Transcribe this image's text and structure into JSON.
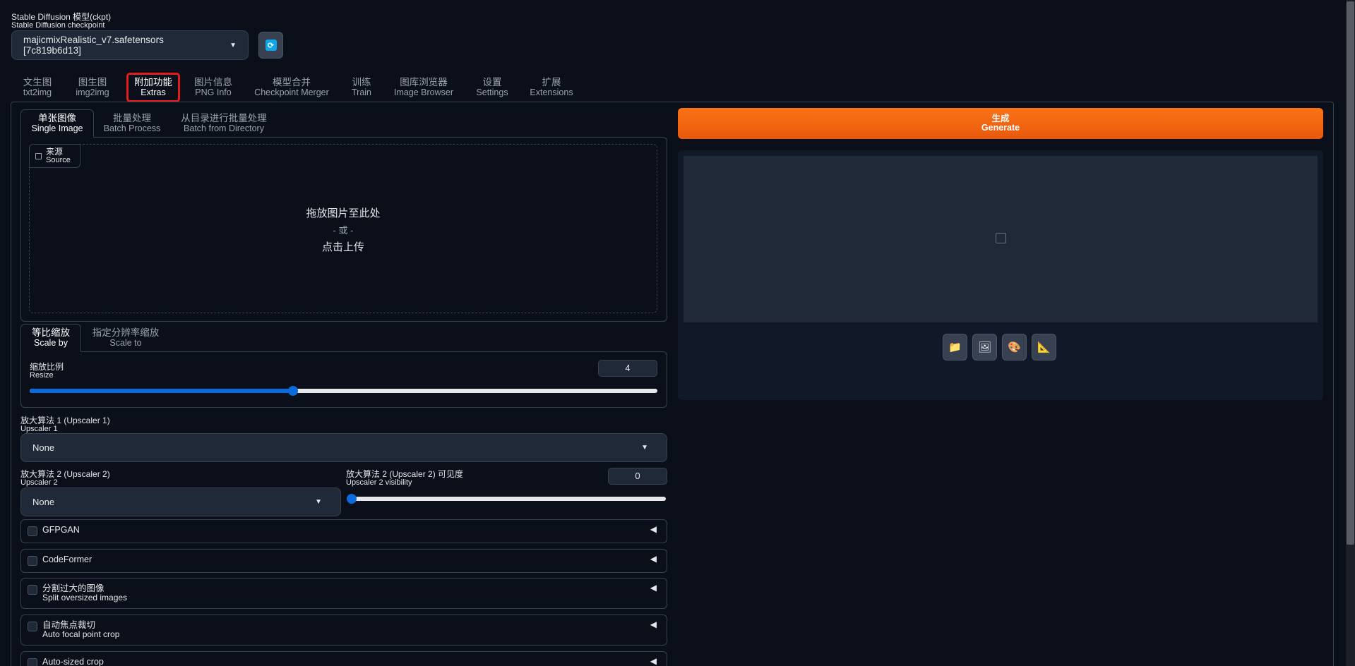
{
  "checkpoint": {
    "label_cn": "Stable Diffusion 模型(ckpt)",
    "label_en": "Stable Diffusion checkpoint",
    "value": "majicmixRealistic_v7.safetensors [7c819b6d13]",
    "refresh_icon": "refresh-icon"
  },
  "main_tabs": [
    {
      "cn": "文生图",
      "en": "txt2img"
    },
    {
      "cn": "图生图",
      "en": "img2img"
    },
    {
      "cn": "附加功能",
      "en": "Extras"
    },
    {
      "cn": "图片信息",
      "en": "PNG Info"
    },
    {
      "cn": "模型合并",
      "en": "Checkpoint Merger"
    },
    {
      "cn": "训练",
      "en": "Train"
    },
    {
      "cn": "图库浏览器",
      "en": "Image Browser"
    },
    {
      "cn": "设置",
      "en": "Settings"
    },
    {
      "cn": "扩展",
      "en": "Extensions"
    }
  ],
  "active_main_tab": "Extras",
  "sub_tabs": [
    {
      "cn": "单张图像",
      "en": "Single Image"
    },
    {
      "cn": "批量处理",
      "en": "Batch Process"
    },
    {
      "cn": "从目录进行批量处理",
      "en": "Batch from Directory"
    }
  ],
  "source": {
    "label_cn": "来源",
    "label_en": "Source",
    "drop_line1": "拖放图片至此处",
    "drop_line2": "- 或 -",
    "drop_line3": "点击上传"
  },
  "scale_tabs": [
    {
      "cn": "等比缩放",
      "en": "Scale by"
    },
    {
      "cn": "指定分辨率缩放",
      "en": "Scale to"
    }
  ],
  "resize": {
    "label_cn": "缩放比例",
    "label_en": "Resize",
    "value": "4",
    "fraction": 0.42
  },
  "upscaler1": {
    "label_cn": "放大算法 1 (Upscaler 1)",
    "label_en": "Upscaler 1",
    "value": "None"
  },
  "upscaler2": {
    "label_cn": "放大算法 2 (Upscaler 2)",
    "label_en": "Upscaler 2",
    "value": "None"
  },
  "upscaler2_visibility": {
    "label_cn": "放大算法 2 (Upscaler 2) 可见度",
    "label_en": "Upscaler 2 visibility",
    "value": "0",
    "fraction": 0
  },
  "accordions": [
    {
      "cn": "GFPGAN",
      "en": ""
    },
    {
      "cn": "CodeFormer",
      "en": ""
    },
    {
      "cn": "分割过大的图像",
      "en": "Split oversized images"
    },
    {
      "cn": "自动焦点裁切",
      "en": "Auto focal point crop"
    },
    {
      "cn": "Auto-sized crop",
      "en": ""
    }
  ],
  "generate": {
    "cn": "生成",
    "en": "Generate"
  },
  "gallery_tools": [
    "folder-icon",
    "image-icon",
    "palette-icon",
    "ruler-icon"
  ],
  "colors": {
    "background": "#0b0f19",
    "generate": "#f97316",
    "slider": "#0b6bdc",
    "active_tab_outline": "#e11d1d"
  }
}
